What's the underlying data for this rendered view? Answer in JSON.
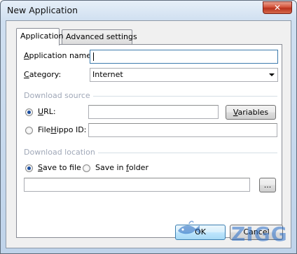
{
  "window": {
    "title": "New Application",
    "close_label": "✕"
  },
  "tabs": [
    {
      "label": "Application",
      "active": true
    },
    {
      "label": "Advanced settings",
      "active": false
    }
  ],
  "form": {
    "app_name_label_pre": "",
    "app_name_label_u": "A",
    "app_name_label_post": "pplication name:",
    "app_name_value": "",
    "category_label_u": "C",
    "category_label_post": "ategory:",
    "category_value": "Internet",
    "download_source_label": "Download source",
    "url_label_u": "U",
    "url_label_post": "RL:",
    "url_value": "",
    "url_checked": true,
    "variables_u": "V",
    "variables_post": "ariables",
    "filehippo_label_pre": "File",
    "filehippo_label_u": "H",
    "filehippo_label_post": "ippo ID:",
    "filehippo_value": "",
    "filehippo_checked": false,
    "download_location_label": "Download location",
    "save_to_file_u": "S",
    "save_to_file_post": "ave to file",
    "save_to_file_checked": true,
    "save_in_folder_pre": "Save in ",
    "save_in_folder_u": "f",
    "save_in_folder_post": "older",
    "save_in_folder_checked": false,
    "path_value": "",
    "browse_label": "..."
  },
  "buttons": {
    "ok": "OK",
    "cancel": "Cancel"
  },
  "watermark": {
    "text": "ZIGG"
  }
}
